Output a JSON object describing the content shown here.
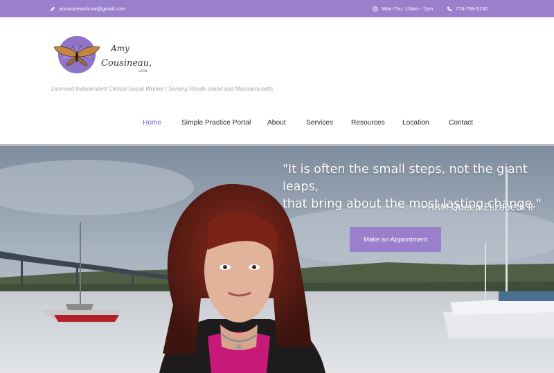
{
  "topbar": {
    "email": "acousineaulicsw@gmail.com",
    "hours": "Mon-Thu: 10am - 7pm",
    "phone": "774-789-5130",
    "background": "#9a7fcc"
  },
  "brand": {
    "logo_first": "Amy",
    "logo_last": "Cousineau,",
    "logo_credential": "LICSW",
    "tagline": "Licensed Independent Clinical Social Worker | Serving Rhode Island and Massachusetts"
  },
  "nav": {
    "items": [
      {
        "label": "Home",
        "active": true
      },
      {
        "label": "Simple Practice Portal"
      },
      {
        "label": "About"
      },
      {
        "label": "Services"
      },
      {
        "label": "Resources"
      },
      {
        "label": "Location"
      },
      {
        "label": "Contact"
      }
    ],
    "active_color": "#7e62c8"
  },
  "hero": {
    "quote_line1": "\"It is often the small steps, not the giant leaps,",
    "quote_line2": "that bring about the most lasting change.\"",
    "quote_author": "- HRM Queen Elizabeth II",
    "cta_label": "Make an Appointment",
    "cta_color": "#9a7fcc"
  }
}
